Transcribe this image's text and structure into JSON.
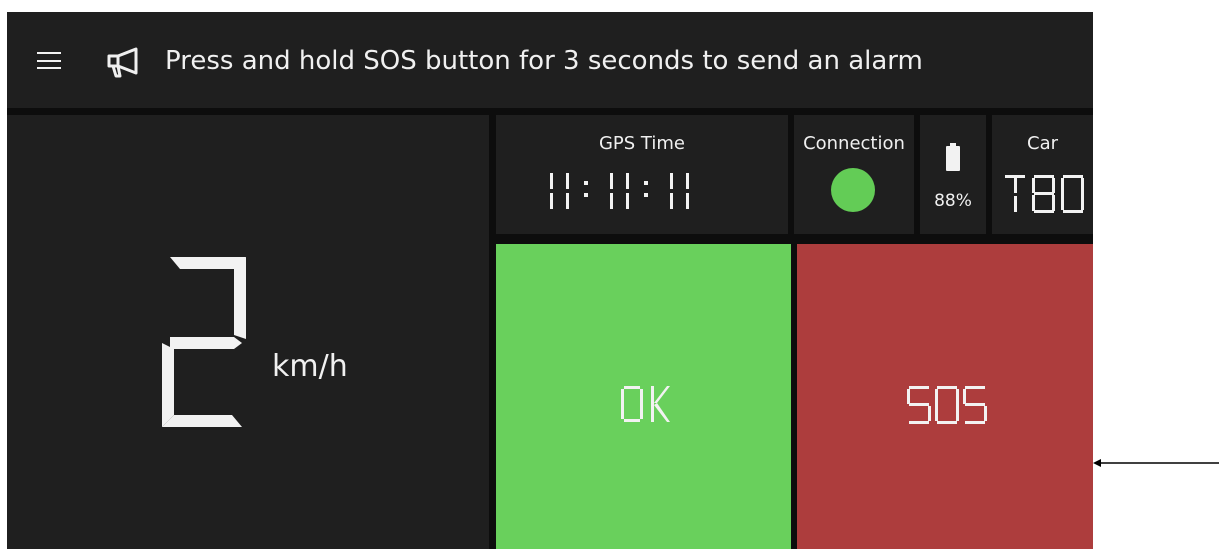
{
  "banner": {
    "menu_icon": "menu-icon",
    "megaphone_icon": "megaphone-icon",
    "text": "Press and hold SOS button for 3 seconds to send an alarm"
  },
  "speed": {
    "value": "2",
    "unit": "km/h"
  },
  "gps": {
    "label": "GPS Time",
    "time": "11:11:11"
  },
  "connection": {
    "label": "Connection",
    "status_color": "#63cc56"
  },
  "battery": {
    "icon": "battery-icon",
    "percent": "88%",
    "level": 0.88
  },
  "car": {
    "label": "Car",
    "id": "T80"
  },
  "buttons": {
    "ok_label": "OK",
    "ok_color": "#69d05c",
    "sos_label": "SOS",
    "sos_color": "#ad3d3d"
  },
  "annotation": {
    "arrow_icon": "arrow-left-icon"
  }
}
